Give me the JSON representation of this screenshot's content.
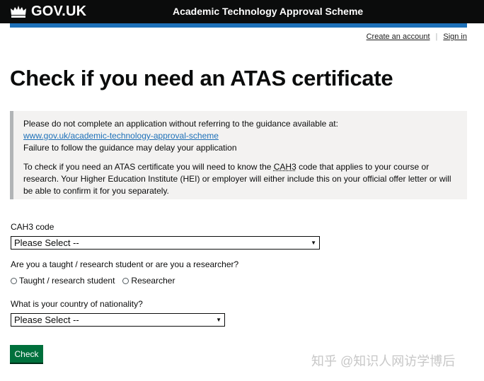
{
  "header": {
    "logo_text": "GOV.UK",
    "service_name": "Academic Technology Approval Scheme"
  },
  "nav": {
    "create_account": "Create an account",
    "separator": "|",
    "sign_in": "Sign in"
  },
  "page_title": "Check if you need an ATAS certificate",
  "inset": {
    "line1": "Please do not complete an application without referring to the guidance available at:",
    "link": "www.gov.uk/academic-technology-approval-scheme",
    "line2": "Failure to follow the guidance may delay your application",
    "para2_before": "To check if you need an ATAS certificate you will need to know the ",
    "para2_abbr": "CAH3",
    "para2_after": " code that applies to your course or research. Your Higher Education Institute (HEI) or employer will either include this on your official offer letter or will be able to confirm it for you separately."
  },
  "form": {
    "cah3_label": "CAH3 code",
    "cah3_value": "Please Select --",
    "role_question": "Are you a taught / research student or are you a researcher?",
    "role_options": [
      "Taught / research student",
      "Researcher"
    ],
    "nationality_label": "What is your country of nationality?",
    "nationality_value": "Please Select --",
    "submit_label": "Check"
  },
  "watermark": "知乎 @知识人网访学博后",
  "colors": {
    "header_bg": "#0b0c0c",
    "accent_bar": "#1d70b8",
    "link": "#1d70b8",
    "inset_bg": "#f3f2f1",
    "inset_border": "#b1b4b6",
    "button": "#00703c"
  },
  "icons": {
    "logo": "crown-icon",
    "select": "chevron-down-icon"
  }
}
